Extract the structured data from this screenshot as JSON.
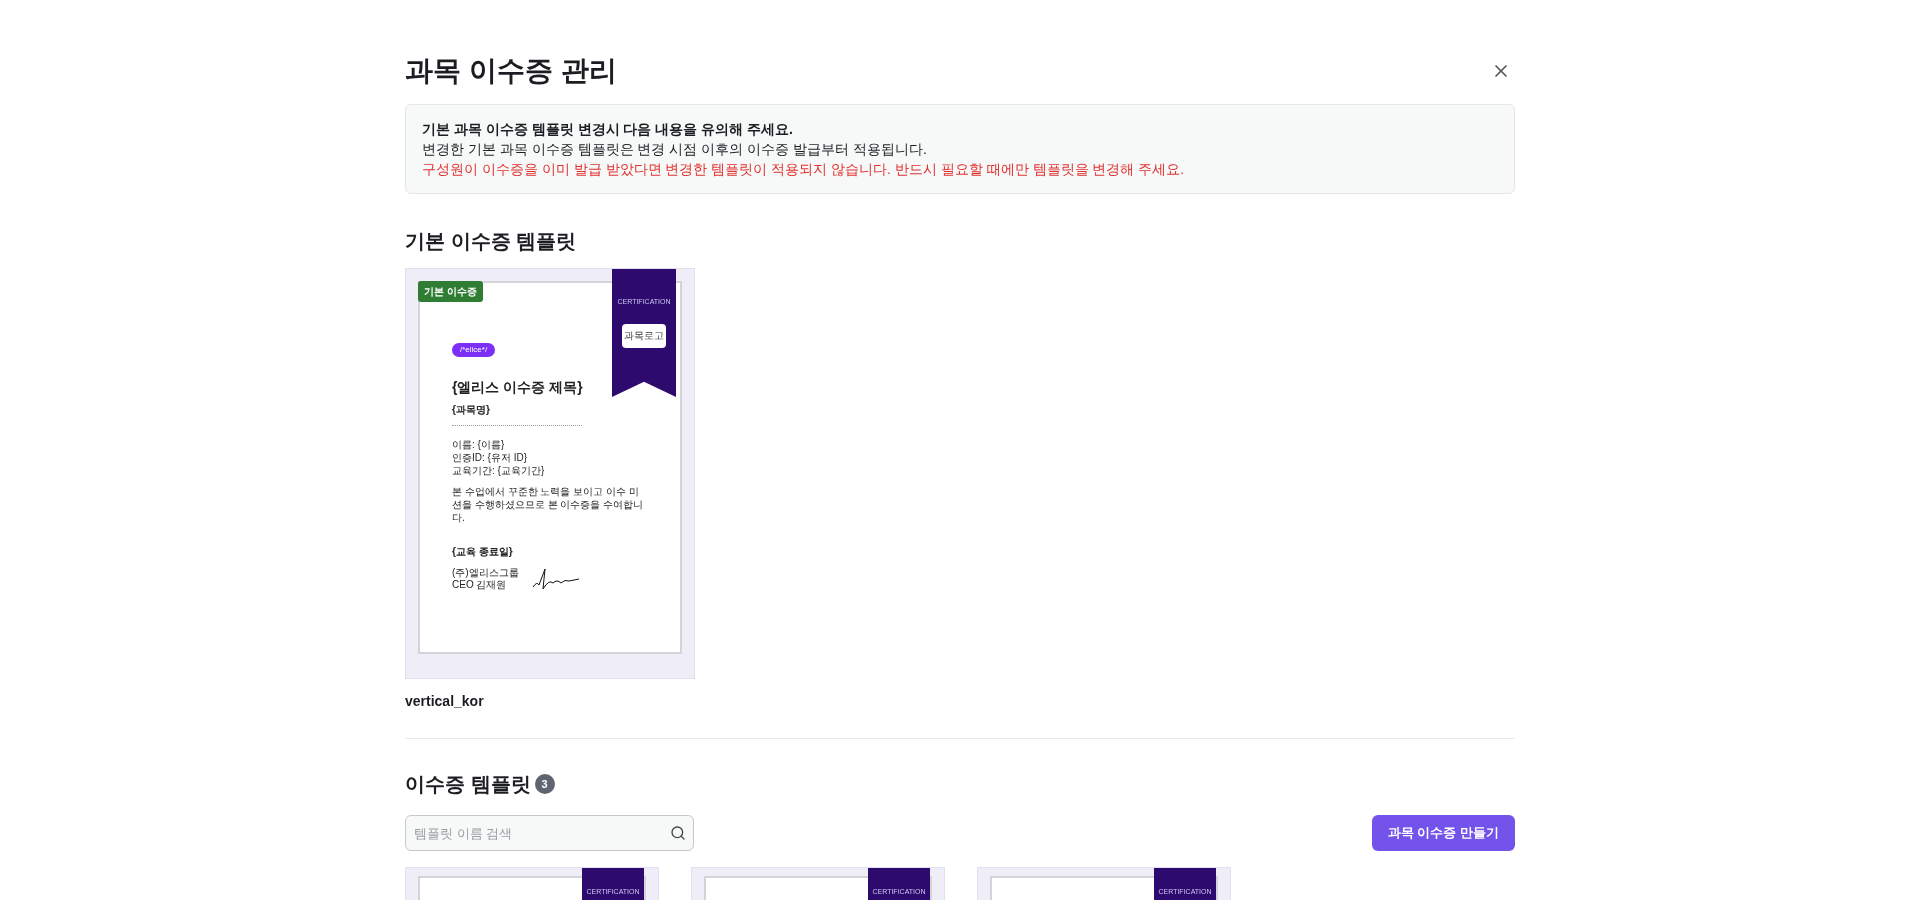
{
  "title": "과목 이수증 관리",
  "notice": {
    "heading": "기본 과목 이수증 템플릿 변경시 다음 내용을 유의해 주세요.",
    "body": "변경한 기본 과목 이수증 템플릿은 변경 시점 이후의 이수증 발급부터 적용됩니다.",
    "warning": "구성원이 이수증을 이미 발급 받았다면 변경한 템플릿이 적용되지 않습니다. 반드시 필요할 때에만 템플릿을 변경해 주세요."
  },
  "default_section": {
    "heading": "기본 이수증 템플릿",
    "template": {
      "badge": "기본 이수증",
      "name": "vertical_kor",
      "certificate": {
        "ribbon": "CERTIFICATION",
        "ribbon_logo": "과목로고",
        "logo": "/*elice*/",
        "title": "{엘리스 이수증 제목}",
        "course": "{과목명}",
        "fields": [
          "이름: {이름}",
          "인증ID: {유저 ID}",
          "교육기간: {교육기간}"
        ],
        "message": "본 수업에서 꾸준한 노력을 보이고 이수 미션을 수행하셨으므로 본 이수증을 수여합니다.",
        "date": "{교육 종료일}",
        "issuer": "(주)엘리스그룹",
        "ceo": "CEO 김재원"
      }
    }
  },
  "templates_section": {
    "heading": "이수증 템플릿",
    "count": "3",
    "search": {
      "placeholder": "템플릿 이름 검색"
    },
    "create_button": "과목 이수증 만들기",
    "cards": [
      {
        "ribbon": "CERTIFICATION"
      },
      {
        "ribbon": "CERTIFICATION"
      },
      {
        "ribbon": "CERTIFICATION"
      }
    ]
  }
}
